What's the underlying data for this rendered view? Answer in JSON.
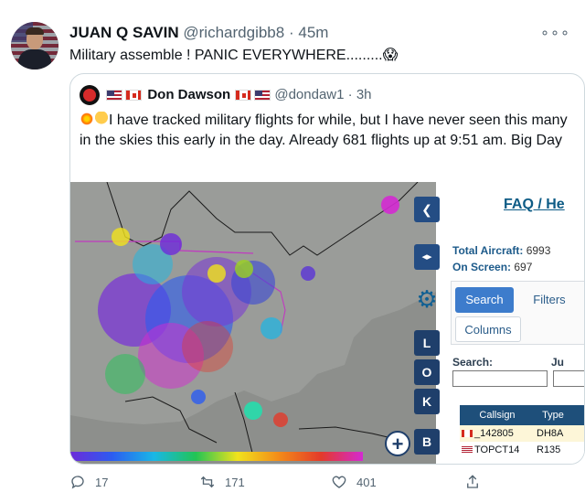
{
  "tweet": {
    "author_name": "JUAN Q SAVIN",
    "handle": "@richardgibb8",
    "separator": "·",
    "time": "45m",
    "more_label": "∘∘∘",
    "text": "Military assemble ! PANIC EVERYWHERE.........",
    "text_emoji": "😱"
  },
  "quote": {
    "author_name": "Don Dawson",
    "handle": "@dondaw1",
    "separator": "·",
    "time": "3h",
    "text": "I have tracked military flights for while, but I have never seen this many in the skies  this early in the day. Already 681 flights up at 9:51 am. Big Day"
  },
  "map_panel": {
    "faq_label": "FAQ / He",
    "total_aircraft_label": "Total Aircraft:",
    "total_aircraft_value": "6993",
    "on_screen_label": "On Screen:",
    "on_screen_value": "697",
    "tab_search": "Search",
    "tab_filters": "Filters",
    "tab_columns": "Columns",
    "search_label": "Search:",
    "search_label2": "Ju",
    "table_headers": [
      "Callsign",
      "Type"
    ],
    "rows": [
      {
        "callsign": "_142805",
        "type": "DH8A",
        "flag": "ca"
      },
      {
        "callsign": "TOPCT14",
        "type": "R135",
        "flag": "us"
      }
    ]
  },
  "map_controls": {
    "back": "❮",
    "expand": "◂▸",
    "gear": "⚙",
    "l": "L",
    "o": "O",
    "k": "K",
    "b": "B",
    "plus": "+"
  },
  "actions": {
    "replies": "17",
    "retweets": "171",
    "likes": "401"
  },
  "colors": {
    "accent": "#1d9bf0",
    "muted": "#536471",
    "map_bg": "#8d8f8c",
    "panel_header": "#1e4f7a"
  }
}
